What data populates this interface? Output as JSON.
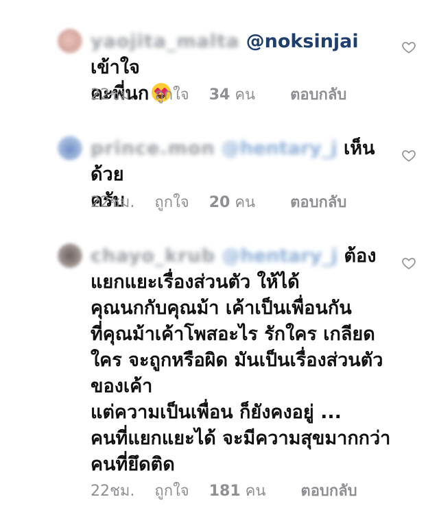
{
  "comments": [
    {
      "username": "yaojita_malta",
      "mention": "@noksinjai",
      "lines": [
        "เข้าใจ",
        "คะพี่นก"
      ],
      "time": "22ชม.",
      "likes_prefix": "ถูกใจ",
      "likes_count": "34",
      "likes_suffix": "คน",
      "reply": "ตอบกลับ"
    },
    {
      "username": "prince.mon",
      "mention": "@hentary_j",
      "lines": [
        "เห็นด้วย",
        "ครับ"
      ],
      "time": "22ชม.",
      "likes_prefix": "ถูกใจ",
      "likes_count": "20",
      "likes_suffix": "คน",
      "reply": "ตอบกลับ"
    },
    {
      "username": "chayo_krub",
      "mention": "@hentary_j",
      "lines": [
        "ต้อง",
        "แยกแยะเรื่องส่วนตัว ให้ได้",
        "คุณนกกับคุณม้า เค้าเป็นเพื่อนกัน",
        "ที่คุณม้าเค้าโพสอะไร รักใคร เกลียด",
        "ใคร จะถูกหรือผิด มันเป็นเรื่องส่วนตัว",
        "ของเค้า",
        "แต่ความเป็นเพื่อน ก็ยังคงอยู่ ...",
        "คนที่แยกแยะได้ จะมีความสุขมากกว่า",
        "คนที่ยึดติด"
      ],
      "time": "22ชม.",
      "likes_prefix": "ถูกใจ",
      "likes_count": "181",
      "likes_suffix": "คน",
      "reply": "ตอบกลับ"
    }
  ],
  "icons": {
    "heart": "heart-outline-icon",
    "emoji": "heart-eyes-emoji"
  },
  "colors": {
    "mention": "#1e3e6e",
    "meta": "#8e8e93"
  }
}
